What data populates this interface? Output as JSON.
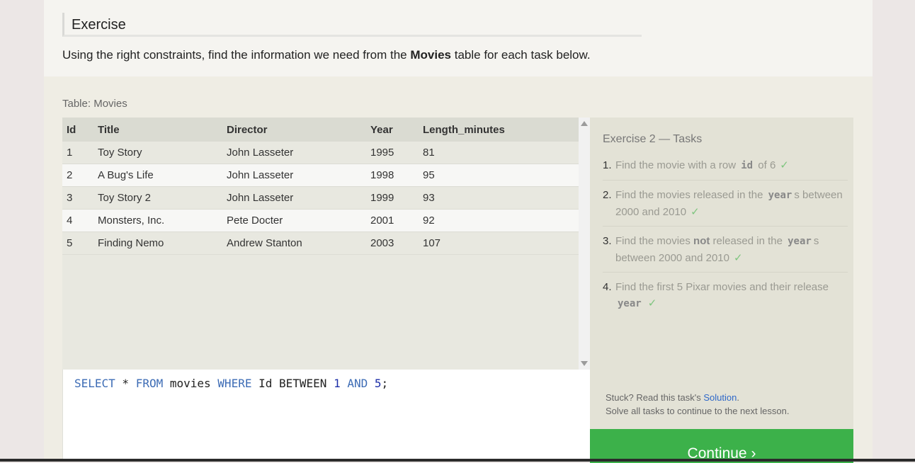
{
  "header": {
    "title": "Exercise",
    "intro_before": "Using the right constraints, find the information we need from the ",
    "intro_table": "Movies",
    "intro_after": " table for each task below."
  },
  "table": {
    "caption": "Table: Movies",
    "columns": [
      "Id",
      "Title",
      "Director",
      "Year",
      "Length_minutes"
    ],
    "rows": [
      [
        "1",
        "Toy Story",
        "John Lasseter",
        "1995",
        "81"
      ],
      [
        "2",
        "A Bug's Life",
        "John Lasseter",
        "1998",
        "95"
      ],
      [
        "3",
        "Toy Story 2",
        "John Lasseter",
        "1999",
        "93"
      ],
      [
        "4",
        "Monsters, Inc.",
        "Pete Docter",
        "2001",
        "92"
      ],
      [
        "5",
        "Finding Nemo",
        "Andrew Stanton",
        "2003",
        "107"
      ]
    ]
  },
  "editor": {
    "tokens": [
      "SELECT",
      " * ",
      "FROM",
      " movies ",
      "WHERE",
      " Id BETWEEN ",
      "1",
      " ",
      "AND",
      " ",
      "5",
      ";"
    ]
  },
  "tasks": {
    "title": "Exercise 2 — Tasks",
    "items": [
      {
        "num": "1.",
        "t1": "Find the movie with a row ",
        "code": "id",
        "t2": " of 6",
        "check": "✓"
      },
      {
        "num": "2.",
        "t1": "Find the movies released in the ",
        "code": "year",
        "t2": "s between 2000 and 2010",
        "check": "✓"
      },
      {
        "num": "3.",
        "t1": "Find the movies ",
        "strong": "not",
        "t1b": " released in the ",
        "code": "year",
        "t2": "s between 2000 and 2010",
        "check": "✓"
      },
      {
        "num": "4.",
        "t1": "Find the first 5 Pixar movies and their release ",
        "code": "year",
        "t2": "",
        "check": "✓"
      }
    ],
    "help_before": "Stuck? Read this task's ",
    "help_link": "Solution",
    "help_after": ".",
    "help_line2": "Solve all tasks to continue to the next lesson."
  },
  "continue_label": "Continue ›",
  "colors": {
    "continue": "#3cb14a",
    "check": "#7ec57e",
    "keyword": "#3d6cb5",
    "link": "#2f68c8"
  }
}
